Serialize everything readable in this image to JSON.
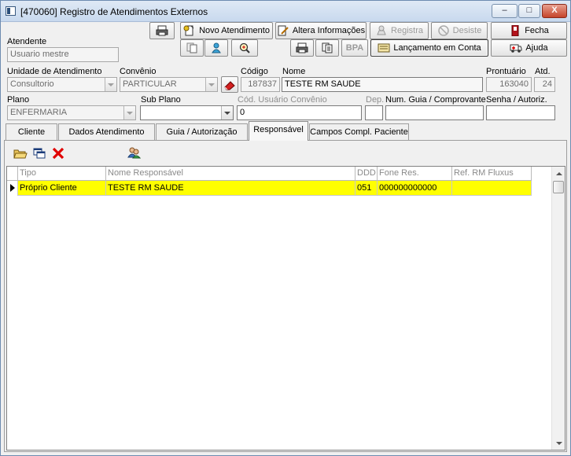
{
  "window": {
    "title": "[470060]  Registro de Atendimentos Externos",
    "minimize": "–",
    "maximize": "□",
    "close": "X"
  },
  "toolbar": {
    "novo_atendimento": "Novo Atendimento",
    "altera_informacoes": "Altera Informações",
    "registra": "Registra",
    "desiste": "Desiste",
    "fecha": "Fecha",
    "bpa": "BPA",
    "lancamento_em_conta": "Lançamento em Conta",
    "ajuda": "Ajuda"
  },
  "form": {
    "atendente": {
      "label": "Atendente",
      "value": "Usuario mestre"
    },
    "unidade": {
      "label": "Unidade de Atendimento",
      "value": "Consultorio"
    },
    "convenio": {
      "label": "Convênio",
      "value": "PARTICULAR"
    },
    "codigo": {
      "label": "Código",
      "value": "187837"
    },
    "nome": {
      "label": "Nome",
      "value": "TESTE RM SAUDE"
    },
    "prontuario": {
      "label": "Prontuário",
      "value": "163040"
    },
    "atd": {
      "label": "Atd.",
      "value": "24"
    },
    "plano": {
      "label": "Plano",
      "value": "ENFERMARIA"
    },
    "sub_plano": {
      "label": "Sub Plano",
      "value": ""
    },
    "cod_usuario": {
      "label": "Cód. Usuário Convênio",
      "value": "0"
    },
    "dep": {
      "label": "Dep.",
      "value": ""
    },
    "num_guia": {
      "label": "Num. Guia / Comprovante",
      "value": ""
    },
    "senha": {
      "label": "Senha / Autoriz.",
      "value": ""
    }
  },
  "tabs": [
    {
      "label": "Cliente",
      "active": false
    },
    {
      "label": "Dados Atendimento",
      "active": false
    },
    {
      "label": "Guia / Autorização",
      "active": false
    },
    {
      "label": "Responsável",
      "active": true
    },
    {
      "label": "Campos Compl. Paciente",
      "active": false
    }
  ],
  "grid": {
    "columns": [
      "Tipo",
      "Nome Responsável",
      "DDD",
      "Fone Res.",
      "Ref. RM Fluxus"
    ],
    "rows": [
      {
        "tipo": "Próprio Cliente",
        "nome": "TESTE RM SAUDE",
        "ddd": "051",
        "fone": "000000000000",
        "ref": ""
      }
    ],
    "selected_row_color": "#ffff00"
  }
}
